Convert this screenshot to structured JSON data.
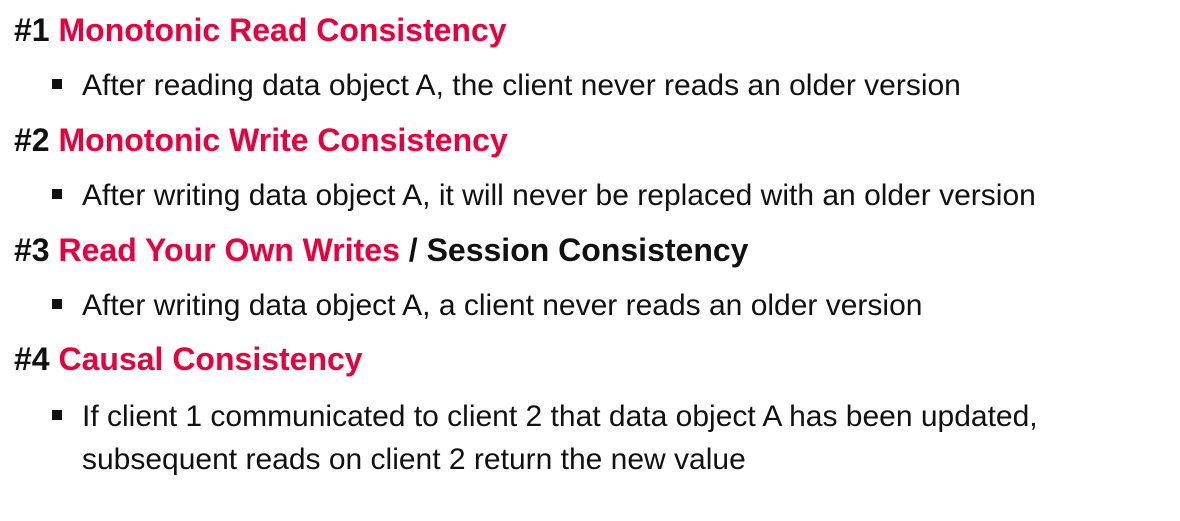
{
  "colors": {
    "accent": "#e8003d",
    "text": "#111111",
    "background": "#ffffff"
  },
  "sections": [
    {
      "number": "#1",
      "title": "Monotonic Read Consistency",
      "bullet": "After reading data object A, the client never reads an older version"
    },
    {
      "number": "#2",
      "title": "Monotonic Write Consistency",
      "bullet": "After writing data object A, it will never be replaced with an older version"
    },
    {
      "number": "#3",
      "title": "Read Your Own Writes",
      "title_suffix": " / Session Consistency",
      "bullet": "After writing data object A, a client never reads an older version"
    },
    {
      "number": "#4",
      "title": "Causal Consistency",
      "bullet": "If client 1 communicated to client 2 that data object A has been updated, subsequent reads on client 2 return the new value"
    }
  ]
}
